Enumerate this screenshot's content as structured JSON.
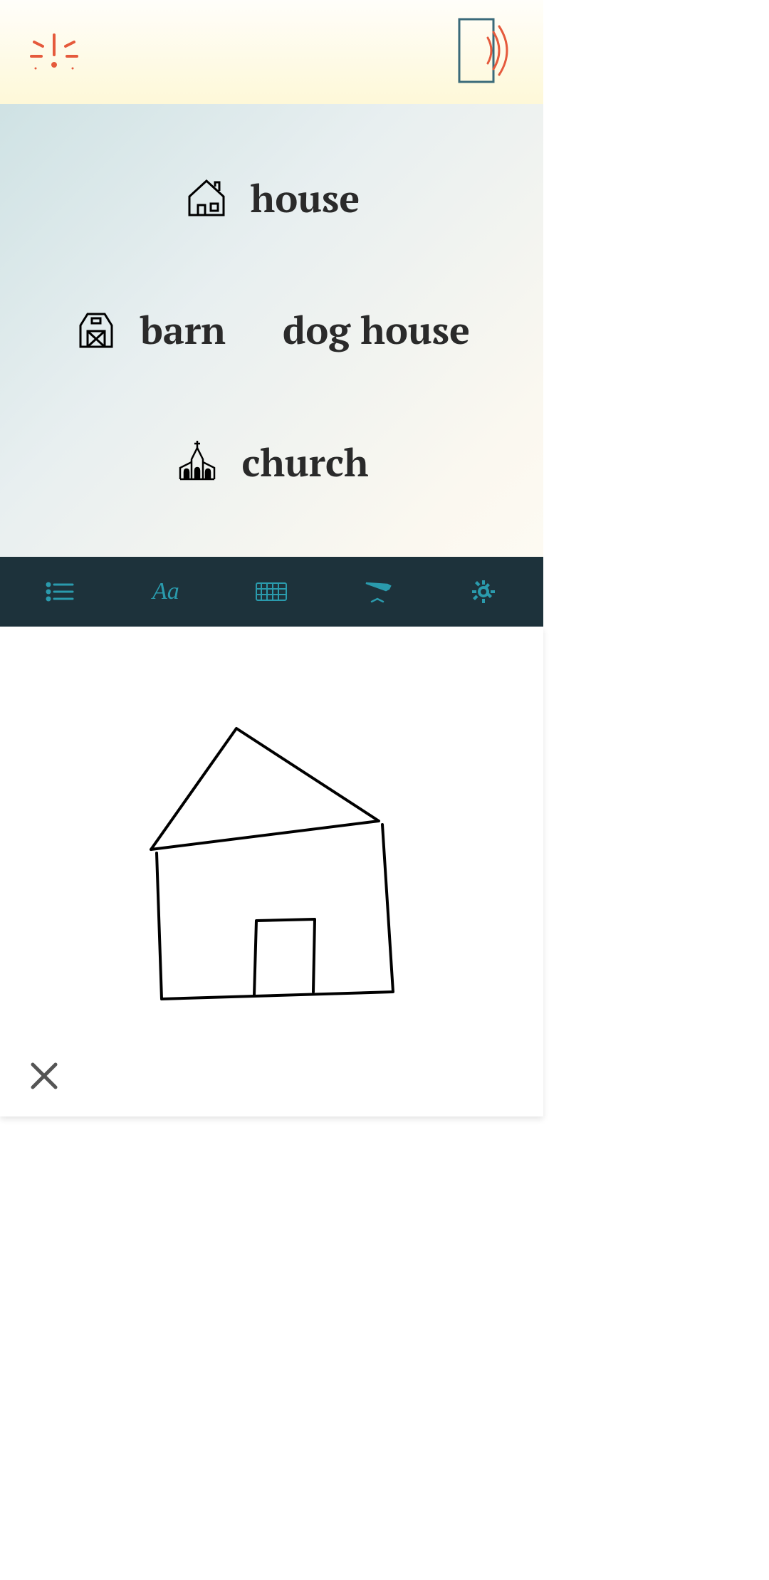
{
  "header": {
    "alert_icon": "alert",
    "speaker_icon": "speaker"
  },
  "suggestions": {
    "row1": {
      "item1": {
        "icon": "house",
        "label": "house"
      }
    },
    "row2": {
      "item1": {
        "icon": "barn",
        "label": "barn"
      },
      "item2": {
        "icon": "",
        "label": "dog house"
      }
    },
    "row3": {
      "item1": {
        "icon": "church",
        "label": "church"
      }
    }
  },
  "toolbar": {
    "list": "list",
    "handwriting": "Aa",
    "keyboard": "keyboard",
    "pen": "pen",
    "settings": "settings"
  },
  "canvas": {
    "clear": "clear"
  }
}
